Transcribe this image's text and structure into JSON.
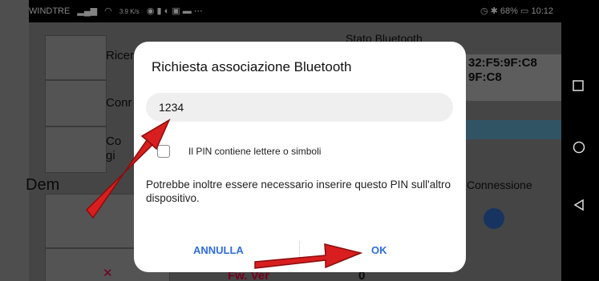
{
  "statusbar": {
    "carrier": "WINDTRE",
    "speed": "3.9 K/s",
    "battery": "68%",
    "time": "10:12"
  },
  "background_app": {
    "row1_label": "Ricer",
    "row2_label": "Conr",
    "row3_label": "Co",
    "row3_label2": "gi",
    "stato_label": "Stato Bluetooth",
    "mac_line1": "32:F5:9F:C8",
    "mac_line2": "9F:C8",
    "dem_label": "Dem",
    "connessione_label": "Connessione",
    "fw_label": "Fw. Ver",
    "fw_value": "0"
  },
  "dialog": {
    "title": "Richiesta associazione Bluetooth",
    "pin_value": "1234",
    "checkbox_label": "Il PIN contiene lettere o simboli",
    "note": "Potrebbe inoltre essere necessario inserire questo PIN sull'altro dispositivo.",
    "cancel_label": "ANNULLA",
    "ok_label": "OK"
  },
  "colors": {
    "accent": "#2f6dd8",
    "arrow": "#d81e1e"
  }
}
